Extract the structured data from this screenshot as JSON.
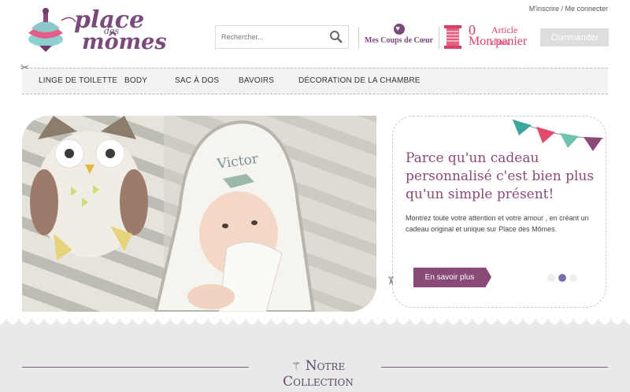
{
  "header": {
    "account_links": "M'inscrire / Me connecter",
    "logo_text": {
      "line1": "place",
      "line2": "des",
      "line3": "mômes"
    },
    "search_placeholder": "Rechercher...",
    "favorites_label": "Mes Coups de Cœur",
    "cart": {
      "count": "0",
      "label_line1": "Article dans",
      "label_line2": "Mon panier"
    },
    "order_button": "Commander"
  },
  "nav": {
    "items": [
      {
        "label": "LINGE DE TOILETTE"
      },
      {
        "label": "BODY"
      },
      {
        "label": "SAC À DOS"
      },
      {
        "label": "BAVOIRS"
      },
      {
        "label": "DÉCORATION DE LA CHAMBRE"
      }
    ]
  },
  "hero": {
    "towel_name": "Victor"
  },
  "promo": {
    "title": "Parce qu'un cadeau personnalisé c'est bien plus qu'un simple présent!",
    "body": "Montrez toute votre attention et votre amour , en créant un cadeau original et unique sur Place des Mômes.",
    "cta": "En savoir plus",
    "bunting_colors": [
      "#3aa6a0",
      "#e04b6a",
      "#6fc1b0",
      "#8a4a78"
    ]
  },
  "collection": {
    "title": "Notre Collection"
  },
  "colors": {
    "brand_purple": "#8a4a78",
    "cart_pink": "#d94065"
  }
}
